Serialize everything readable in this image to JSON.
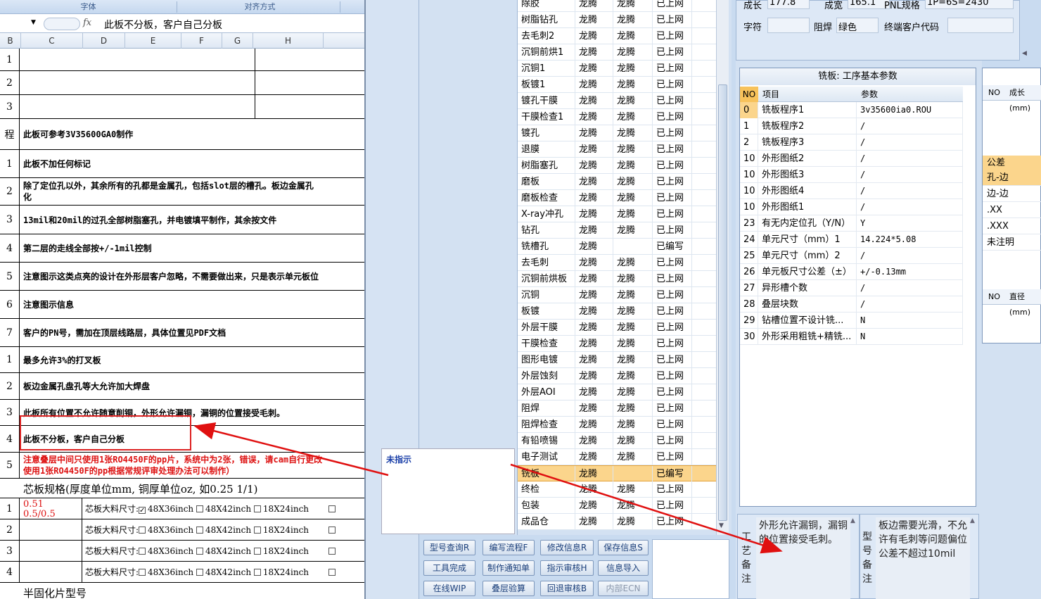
{
  "excel": {
    "ribbon": {
      "font": "字体",
      "align": "对齐方式"
    },
    "formula_text": "此板不分板，客户自己分板",
    "fx": "fx",
    "cols": [
      "B",
      "C",
      "D",
      "E",
      "F",
      "G",
      "H"
    ],
    "rows": [
      {
        "num": "1",
        "text": ""
      },
      {
        "num": "2",
        "text": ""
      },
      {
        "num": "3",
        "text": ""
      },
      {
        "num": "程",
        "text": "此板可参考3V35600GA0制作"
      },
      {
        "num": "1",
        "text": "此板不加任何标记"
      },
      {
        "num": "2",
        "text": "除了定位孔以外，其余所有的孔都是金属孔，包括slot层的槽孔。板边金属孔",
        "text2": "化"
      },
      {
        "num": "3",
        "text": "13mil和20mil的过孔全部树脂塞孔，并电镀填平制作，其余按文件"
      },
      {
        "num": "4",
        "text": "第二层的走线全部按+/-1mil控制"
      },
      {
        "num": "5",
        "text": "注意图示这类点亮的设计在外形层客户忽略，不需要做出来，只是表示单元板位"
      },
      {
        "num": "6",
        "text": "注意图示信息"
      },
      {
        "num": "7",
        "text": "客户的PN号，需加在顶层线路层，具体位置见PDF文档"
      },
      {
        "num": "1",
        "text": "最多允许3%的打叉板"
      },
      {
        "num": "2",
        "text": "板边金属孔盘孔等大允许加大焊盘"
      },
      {
        "num": "3",
        "text": "此板所有位置不允许随意削铜，外形允许漏铜，漏铜的位置接受毛刺。"
      },
      {
        "num": "4",
        "text": "此板不分板，客户自己分板"
      },
      {
        "num": "5",
        "text": "注意叠层中间只使用1张RO4450F的pp片，系统中为2张，错误，请cam自行更改",
        "text2": "使用1张RO4450F的pp根据常规评审处理办法可以制作）"
      }
    ],
    "core_title": "芯板规格(厚度单位mm, 铜厚单位oz, 如0.25 1/1)",
    "core_rows": [
      {
        "num": "1",
        "val": "0.51",
        "val2": "0.5/0.5",
        "label": "芯板大料尺寸:",
        "o1": "48X36inch",
        "o2": "48X42inch",
        "o3": "18X24inch",
        "checked": true
      },
      {
        "num": "2",
        "val": "",
        "val2": "",
        "label": "芯板大料尺寸:",
        "o1": "48X36inch",
        "o2": "48X42inch",
        "o3": "18X24inch",
        "checked": false
      },
      {
        "num": "3",
        "val": "",
        "val2": "",
        "label": "芯板大料尺寸:",
        "o1": "48X36inch",
        "o2": "48X42inch",
        "o3": "18X24inch",
        "checked": false
      },
      {
        "num": "4",
        "val": "",
        "val2": "",
        "label": "芯板大料尺寸:",
        "o1": "48X36inch",
        "o2": "48X42inch",
        "o3": "18X24inch",
        "checked": false
      }
    ],
    "prepreg_title": "半固化片型号"
  },
  "popup_label": "未指示",
  "process": [
    {
      "name": "除胶",
      "a": "龙腾",
      "b": "龙腾",
      "s": "已上网"
    },
    {
      "name": "树脂钻孔",
      "a": "龙腾",
      "b": "龙腾",
      "s": "已上网"
    },
    {
      "name": "去毛刺2",
      "a": "龙腾",
      "b": "龙腾",
      "s": "已上网"
    },
    {
      "name": "沉铜前烘1",
      "a": "龙腾",
      "b": "龙腾",
      "s": "已上网"
    },
    {
      "name": "沉铜1",
      "a": "龙腾",
      "b": "龙腾",
      "s": "已上网"
    },
    {
      "name": "板镀1",
      "a": "龙腾",
      "b": "龙腾",
      "s": "已上网"
    },
    {
      "name": "镀孔干膜",
      "a": "龙腾",
      "b": "龙腾",
      "s": "已上网"
    },
    {
      "name": "干膜检查1",
      "a": "龙腾",
      "b": "龙腾",
      "s": "已上网"
    },
    {
      "name": "镀孔",
      "a": "龙腾",
      "b": "龙腾",
      "s": "已上网"
    },
    {
      "name": "退膜",
      "a": "龙腾",
      "b": "龙腾",
      "s": "已上网"
    },
    {
      "name": "树脂塞孔",
      "a": "龙腾",
      "b": "龙腾",
      "s": "已上网"
    },
    {
      "name": "磨板",
      "a": "龙腾",
      "b": "龙腾",
      "s": "已上网"
    },
    {
      "name": "磨板检查",
      "a": "龙腾",
      "b": "龙腾",
      "s": "已上网"
    },
    {
      "name": "X-ray冲孔",
      "a": "龙腾",
      "b": "龙腾",
      "s": "已上网"
    },
    {
      "name": "钻孔",
      "a": "龙腾",
      "b": "龙腾",
      "s": "已上网"
    },
    {
      "name": "铣槽孔",
      "a": "龙腾",
      "b": "",
      "s": "已编写"
    },
    {
      "name": "去毛刺",
      "a": "龙腾",
      "b": "龙腾",
      "s": "已上网"
    },
    {
      "name": "沉铜前烘板",
      "a": "龙腾",
      "b": "龙腾",
      "s": "已上网"
    },
    {
      "name": "沉铜",
      "a": "龙腾",
      "b": "龙腾",
      "s": "已上网"
    },
    {
      "name": "板镀",
      "a": "龙腾",
      "b": "龙腾",
      "s": "已上网"
    },
    {
      "name": "外层干膜",
      "a": "龙腾",
      "b": "龙腾",
      "s": "已上网"
    },
    {
      "name": "干膜检查",
      "a": "龙腾",
      "b": "龙腾",
      "s": "已上网"
    },
    {
      "name": "图形电镀",
      "a": "龙腾",
      "b": "龙腾",
      "s": "已上网"
    },
    {
      "name": "外层蚀刻",
      "a": "龙腾",
      "b": "龙腾",
      "s": "已上网"
    },
    {
      "name": "外层AOI",
      "a": "龙腾",
      "b": "龙腾",
      "s": "已上网"
    },
    {
      "name": "阻焊",
      "a": "龙腾",
      "b": "龙腾",
      "s": "已上网"
    },
    {
      "name": "阻焊检查",
      "a": "龙腾",
      "b": "龙腾",
      "s": "已上网"
    },
    {
      "name": "有铅喷锡",
      "a": "龙腾",
      "b": "龙腾",
      "s": "已上网"
    },
    {
      "name": "电子测试",
      "a": "龙腾",
      "b": "龙腾",
      "s": "已上网"
    },
    {
      "name": "铣板",
      "a": "龙腾",
      "b": "",
      "s": "已编写",
      "selected": true
    },
    {
      "name": "终检",
      "a": "龙腾",
      "b": "龙腾",
      "s": "已上网"
    },
    {
      "name": "包装",
      "a": "龙腾",
      "b": "龙腾",
      "s": "已上网"
    },
    {
      "name": "成品仓",
      "a": "龙腾",
      "b": "龙腾",
      "s": "已上网"
    }
  ],
  "buttons": [
    [
      "型号查询R",
      "编写流程F",
      "修改信息R",
      "保存信息S"
    ],
    [
      "工具完成",
      "制作通知单",
      "指示审核H",
      "信息导入"
    ],
    [
      "在线WIP",
      "叠层验算",
      "回退审核B",
      "内部ECN"
    ]
  ],
  "info": {
    "len_label": "成长",
    "len_val": "177.8",
    "wid_label": "成宽",
    "wid_val": "165.1",
    "pnl_label": "PNL规格",
    "pnl_val": "1P=6S=2430",
    "char_label": "字符",
    "char_val": "",
    "mask_label": "阻焊",
    "mask_val": "绿色",
    "cust_label": "终端客户代码",
    "cust_val": ""
  },
  "mill": {
    "title": "铣板: 工序基本参数",
    "headers": [
      "NO",
      "项目",
      "参数"
    ],
    "rows": [
      [
        "0",
        "铣板程序1",
        "3v35600ia0.ROU"
      ],
      [
        "1",
        "铣板程序2",
        "/"
      ],
      [
        "2",
        "铣板程序3",
        "/"
      ],
      [
        "10",
        "外形图纸2",
        "/"
      ],
      [
        "10",
        "外形图纸3",
        "/"
      ],
      [
        "10",
        "外形图纸4",
        "/"
      ],
      [
        "10",
        "外形图纸1",
        "/"
      ],
      [
        "23",
        "有无内定位孔（Y/N）",
        "Y"
      ],
      [
        "24",
        "单元尺寸（mm）1",
        "14.224*5.08"
      ],
      [
        "25",
        "单元尺寸（mm）2",
        "/"
      ],
      [
        "26",
        "单元板尺寸公差（±）",
        "+/-0.13mm"
      ],
      [
        "27",
        "异形槽个数",
        "/"
      ],
      [
        "28",
        "叠层块数",
        "/"
      ],
      [
        "29",
        "钻槽位置不设计铣...",
        "N"
      ],
      [
        "30",
        "外形采用粗铣+精铣...",
        "N"
      ]
    ]
  },
  "far": {
    "h1": [
      "NO",
      "成长(mm)"
    ],
    "items": [
      "公差",
      "孔-边",
      "边-边",
      ".XX",
      ".XXX",
      "未注明"
    ],
    "h2": [
      "NO",
      "直径(mm)"
    ]
  },
  "notes": {
    "craft_label": "工艺备注",
    "craft_text": "外形允许漏铜，漏铜的位置接受毛刺。",
    "model_label": "型号备注",
    "model_text": "板边需要光滑，不允许有毛刺等问题偏位公差不超过10mil"
  }
}
